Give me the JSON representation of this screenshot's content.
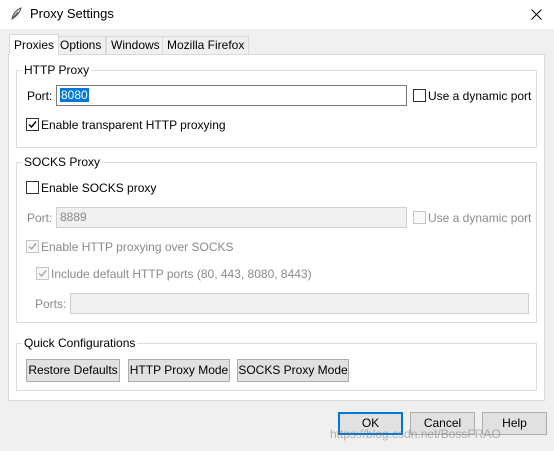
{
  "window": {
    "title": "Proxy Settings",
    "icon": "app-feather-icon"
  },
  "tabs": [
    {
      "label": "Proxies",
      "active": true
    },
    {
      "label": "Options"
    },
    {
      "label": "Windows"
    },
    {
      "label": "Mozilla Firefox"
    }
  ],
  "http_proxy": {
    "group_label": "HTTP Proxy",
    "port_label": "Port:",
    "port_value": "8080",
    "dynamic_port_label": "Use a dynamic port",
    "dynamic_port_checked": false,
    "transparent_label": "Enable transparent HTTP proxying",
    "transparent_checked": true
  },
  "socks_proxy": {
    "group_label": "SOCKS Proxy",
    "enable_label": "Enable SOCKS proxy",
    "enable_checked": false,
    "port_label": "Port:",
    "port_value": "8889",
    "dynamic_port_label": "Use a dynamic port",
    "http_over_socks_label": "Enable HTTP proxying over SOCKS",
    "http_over_socks_checked": true,
    "include_ports_label": "Include default HTTP ports (80, 443, 8080, 8443)",
    "include_ports_checked": true,
    "ports_label": "Ports:",
    "ports_value": ""
  },
  "quick": {
    "group_label": "Quick Configurations",
    "restore_label": "Restore Defaults",
    "http_mode_label": "HTTP Proxy Mode",
    "socks_mode_label": "SOCKS Proxy Mode"
  },
  "footer": {
    "ok_label": "OK",
    "cancel_label": "Cancel",
    "help_label": "Help",
    "watermark": "https://blog.csdn.net/BossFRAO"
  },
  "colors": {
    "selection": "#0078d7",
    "default_button_border": "#0078d7"
  }
}
